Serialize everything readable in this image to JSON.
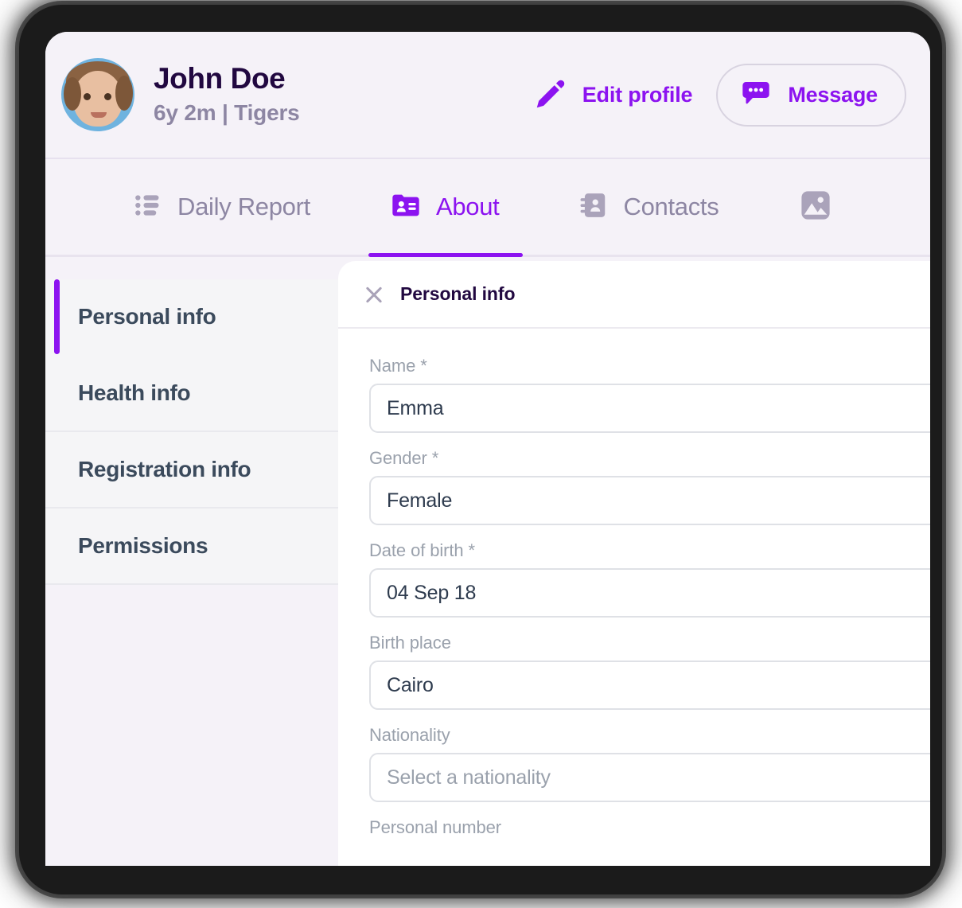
{
  "theme": {
    "accent": "#8c13f0",
    "header_bg": "#f5f2f8",
    "panel_bg": "#ffffff",
    "sidenav_bg": "#f5f5f7",
    "muted_text": "#8d86a3",
    "dark_text": "#210840"
  },
  "profile": {
    "avatar_icon": "child-avatar-photo",
    "name": "John Doe",
    "subtitle": "6y 2m | Tigers",
    "edit_profile_label": "Edit profile",
    "edit_profile_icon": "pencil-icon",
    "message_label": "Message",
    "message_icon": "chat-bubble-icon"
  },
  "tabs": [
    {
      "label": "Daily Report",
      "icon": "list-icon",
      "active": false
    },
    {
      "label": "About",
      "icon": "id-card-icon",
      "active": true
    },
    {
      "label": "Contacts",
      "icon": "address-book-icon",
      "active": false
    },
    {
      "label": "",
      "icon": "image-gallery-icon",
      "active": false
    }
  ],
  "side_nav": {
    "items": [
      {
        "label": "Personal info",
        "active": true
      },
      {
        "label": "Health info",
        "active": false
      },
      {
        "label": "Registration info",
        "active": false
      },
      {
        "label": "Permissions",
        "active": false
      }
    ]
  },
  "panel": {
    "title": "Personal info",
    "close_icon": "close-icon",
    "fields": [
      {
        "label": "Name *",
        "value": "Emma",
        "placeholder": "",
        "is_placeholder": false
      },
      {
        "label": "Gender *",
        "value": "Female",
        "placeholder": "",
        "is_placeholder": false
      },
      {
        "label": "Date of birth *",
        "value": "04 Sep 18",
        "placeholder": "",
        "is_placeholder": false
      },
      {
        "label": "Birth place",
        "value": "Cairo",
        "placeholder": "",
        "is_placeholder": false
      },
      {
        "label": "Nationality",
        "value": "Select a nationality",
        "placeholder": "Select a nationality",
        "is_placeholder": true
      },
      {
        "label": "Personal number",
        "value": "",
        "placeholder": "",
        "is_placeholder": false
      }
    ]
  }
}
